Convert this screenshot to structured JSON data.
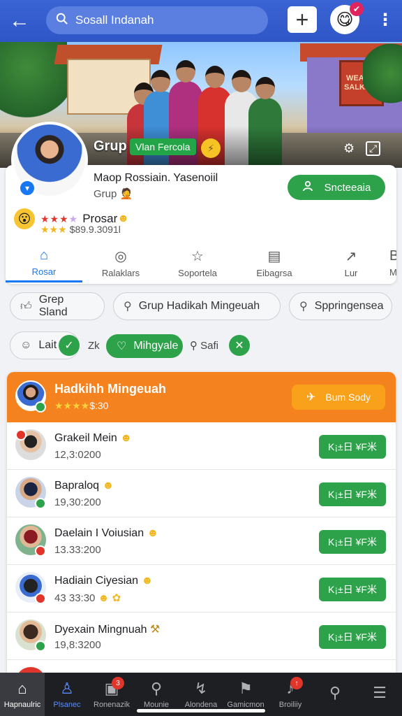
{
  "topbar": {
    "search_text": "Sosall Indanah",
    "plus_label": "+",
    "badge": "✔"
  },
  "cover": {
    "sign_line1": "WEAIRE",
    "sign_line2": "SALKDMI",
    "title": "Grup",
    "tag": "Vlan Fercola"
  },
  "card": {
    "title": "Maop Rossiain. Yasenoiil",
    "subtitle": "Grup",
    "join_label": "Sncteeaia",
    "rating_name": "Prosar",
    "rating_value": "$89.9.3091l",
    "tabs": [
      {
        "label": "Rosar",
        "icon": "home-icon"
      },
      {
        "label": "Ralaklars",
        "icon": "clock-icon"
      },
      {
        "label": "Soportela",
        "icon": "star-icon"
      },
      {
        "label": "Eibagrsa",
        "icon": "list-icon"
      },
      {
        "label": "Lur",
        "icon": "share-icon"
      },
      {
        "label": "M",
        "icon": "more-icon"
      }
    ]
  },
  "chips": {
    "row1": [
      "Grep Sland",
      "Grup   Hadikah Mingeuah",
      "Sppringensea"
    ],
    "lait": "Lait",
    "zk": "Zk",
    "green": "Mihgyale",
    "safi": "Safi"
  },
  "panel": {
    "title": "Hadkihh Mingeuah",
    "rating": "$:30",
    "button": "Bum Sody",
    "rows": [
      {
        "name": "Grakeil Mein",
        "time": "12,3:0200",
        "button": "K¡±日 ¥F米",
        "mini_color": "#e0352b"
      },
      {
        "name": "Bapraloq",
        "time": "19,30:200",
        "button": "K¡±日 ¥F米",
        "mini_color": "#2ea24a"
      },
      {
        "name": "Daelain I Voiusian",
        "time": "13.33:200",
        "button": "K¡±日 ¥F米",
        "mini_color": "#e0352b"
      },
      {
        "name": "Hadiain Ciyesian",
        "time": "43 33:30",
        "button": "K¡±日 ¥F米",
        "mini_color": "#e0352b"
      },
      {
        "name": "Dyexain Mingnuah",
        "time": "19,8:3200",
        "button": "K¡±日 ¥F米",
        "mini_color": "#2ea24a"
      }
    ]
  },
  "bottomnav": [
    {
      "label": "Hapnaulric",
      "icon": "home-icon"
    },
    {
      "label": "Plsanec",
      "icon": "person-icon"
    },
    {
      "label": "Ronenazik",
      "icon": "message-icon",
      "badge": "3"
    },
    {
      "label": "Mounie",
      "icon": "search-icon"
    },
    {
      "label": "Alondena",
      "icon": "chart-icon"
    },
    {
      "label": "Gamicmon",
      "icon": "gamepad-icon"
    },
    {
      "label": "Broiliiy",
      "icon": "bell-icon",
      "badge": "↑"
    },
    {
      "label": "",
      "icon": "search-icon"
    },
    {
      "label": "",
      "icon": "menu-icon"
    }
  ]
}
